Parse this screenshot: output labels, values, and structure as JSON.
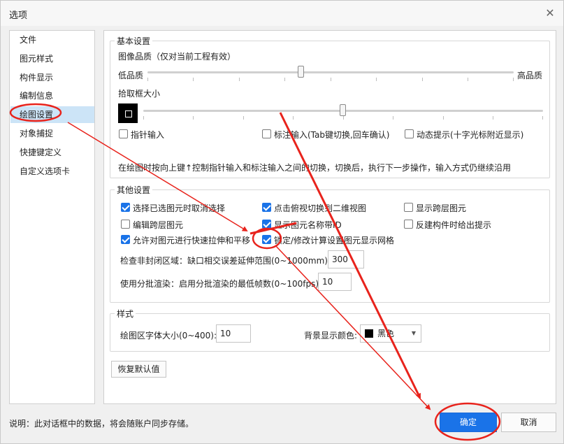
{
  "window": {
    "title": "选项",
    "close_icon": "close-icon"
  },
  "sidebar": {
    "items": [
      {
        "label": "文件"
      },
      {
        "label": "图元样式"
      },
      {
        "label": "构件显示"
      },
      {
        "label": "编制信息"
      },
      {
        "label": "绘图设置",
        "selected": true
      },
      {
        "label": "对象捕捉"
      },
      {
        "label": "快捷键定义"
      },
      {
        "label": "自定义选项卡"
      }
    ]
  },
  "basic": {
    "legend": "基本设置",
    "image_quality_label": "图像品质（仅对当前工程有效）",
    "low_label": "低品质",
    "high_label": "高品质",
    "image_quality_value": 0.42,
    "pick_label": "拾取框大小",
    "pick_value": 0.5,
    "options": [
      {
        "label": "指针输入",
        "checked": false
      },
      {
        "label": "标注输入(Tab键切换,回车确认)",
        "checked": false
      },
      {
        "label": "动态提示(十字光标附近显示)",
        "checked": false
      }
    ],
    "note": "在绘图时按向上键↑控制指针输入和标注输入之间的切换，切换后，执行下一步操作，输入方式仍继续沿用"
  },
  "other": {
    "legend": "其他设置",
    "options": [
      {
        "label": "选择已选图元时取消选择",
        "checked": true
      },
      {
        "label": "点击俯视切换到二维视图",
        "checked": true
      },
      {
        "label": "显示跨层图元",
        "checked": false
      },
      {
        "label": "编辑跨层图元",
        "checked": false
      },
      {
        "label": "显示图元名称带ID",
        "checked": true
      },
      {
        "label": "反建构件时给出提示",
        "checked": false
      },
      {
        "label": "允许对图元进行快速拉伸和平移",
        "checked": true
      },
      {
        "label": "锁定/修改计算设置图元显示网格",
        "checked": true
      }
    ],
    "gap_label": "检查非封闭区域：缺口相交误差延伸范围(0~1000mm):",
    "gap_value": "300",
    "batch_label": "使用分批渲染：启用分批渲染的最低帧数(0~100fps):",
    "batch_value": "10"
  },
  "style": {
    "legend": "样式",
    "font_size_label": "绘图区字体大小(0~400):",
    "font_size_value": "10",
    "bg_label": "背景显示颜色:",
    "bg_value": "黑色",
    "bg_color": "#000000"
  },
  "restore_button": "恢复默认值",
  "footer": {
    "note": "说明：此对话框中的数据，将会随账户同步存储。",
    "ok": "确定",
    "cancel": "取消"
  },
  "annotation_color": "#e8231c"
}
